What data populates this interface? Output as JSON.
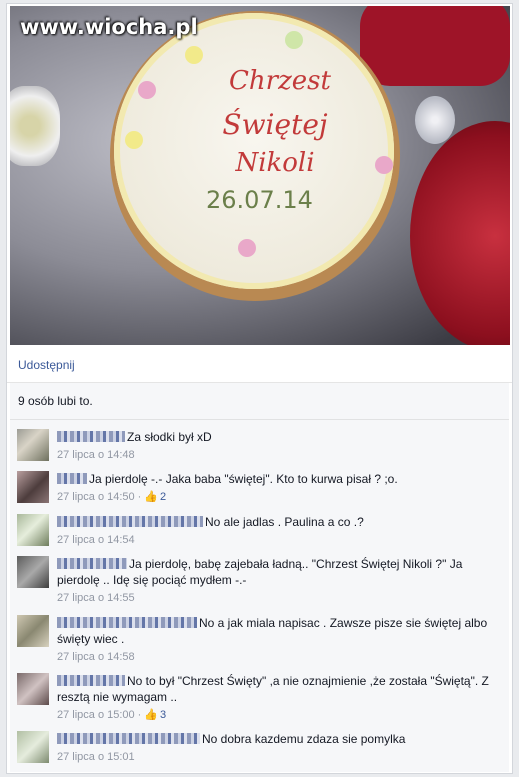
{
  "photo": {
    "watermark": "www.wiocha.pl",
    "cake_line1": "Chrzest",
    "cake_line2": "Świętej",
    "cake_line3": "Nikoli",
    "cake_date": "26.07.14"
  },
  "actions": {
    "share_label": "Udostępnij"
  },
  "likes": {
    "text": "9 osób lubi to."
  },
  "comments": [
    {
      "text": "Za słodki był xD",
      "time": "27 lipca o 14:48",
      "likes": ""
    },
    {
      "text": "Ja pierdolę -.- Jaka baba \"świętej\". Kto to kurwa pisał ? ;o.",
      "time": "27 lipca o 14:50",
      "likes": "2"
    },
    {
      "text": "No ale jadlas . Paulina a co .?",
      "time": "27 lipca o 14:54",
      "likes": ""
    },
    {
      "text": "Ja pierdolę, babę zajebała ładną.. \"Chrzest Świętej Nikoli ?\" Ja pierdolę .. Idę się pociąć mydłem -.-",
      "time": "27 lipca o 14:55",
      "likes": ""
    },
    {
      "text": "No a jak miala napisac . Zawsze pisze sie świętej albo święty wiec .",
      "time": "27 lipca o 14:58",
      "likes": ""
    },
    {
      "text": "No to był \"Chrzest Święty\" ,a nie oznajmienie ,że została \"Świętą\". Z resztą nie wymagam ..",
      "time": "27 lipca o 15:00",
      "likes": "3"
    },
    {
      "text": "No dobra kazdemu zdaza sie pomylka",
      "time": "27 lipca o 15:01",
      "likes": ""
    }
  ]
}
